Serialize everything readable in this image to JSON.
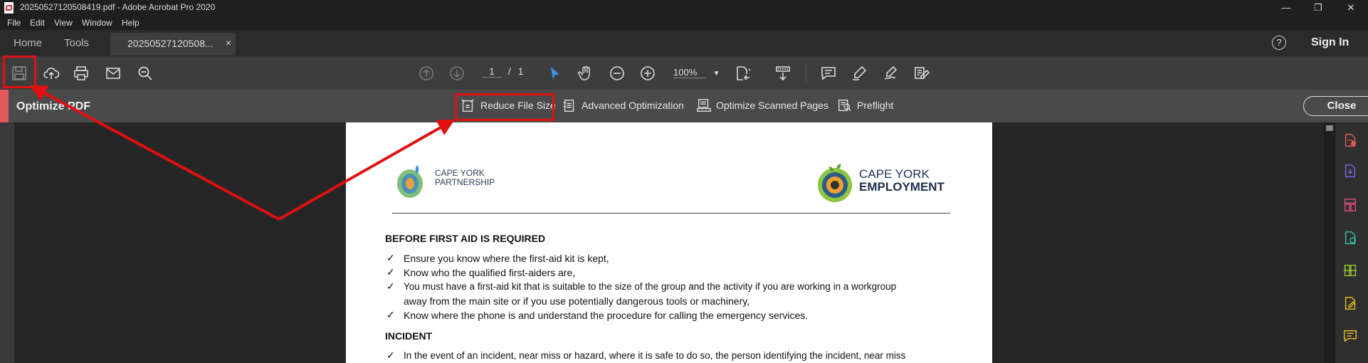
{
  "window": {
    "title": "20250527120508419.pdf - Adobe Acrobat Pro 2020",
    "controls": {
      "minimize": "—",
      "restore": "❐",
      "close": "✕"
    }
  },
  "menu": [
    "File",
    "Edit",
    "View",
    "Window",
    "Help"
  ],
  "tabs": {
    "home": "Home",
    "tools": "Tools",
    "document": "20250527120508...",
    "close": "×"
  },
  "header": {
    "help": "?",
    "sign_in": "Sign In"
  },
  "toolbar": {
    "page_current": "1",
    "page_sep": "/",
    "page_total": "1",
    "zoom": "100%"
  },
  "optimize_bar": {
    "title": "Optimize PDF",
    "tools": [
      "Reduce File Size",
      "Advanced Optimization",
      "Optimize Scanned Pages",
      "Preflight"
    ],
    "close": "Close"
  },
  "document": {
    "logo_left": [
      "CAPE YORK",
      "PARTNERSHIP"
    ],
    "logo_right": [
      "CAPE YORK",
      "EMPLOYMENT"
    ],
    "heading1": "BEFORE FIRST AID IS REQUIRED",
    "items": [
      "Ensure you know where the first-aid kit is kept,",
      "Know who the qualified first-aiders are,",
      "You must have a first-aid kit that is suitable to the size of the group and the activity if you are working in a workgroup",
      "away from the main site or if you use potentially dangerous tools or machinery,",
      "Know where the phone is and understand the procedure for calling the emergency services."
    ],
    "heading2": "INCIDENT",
    "item_incident": "In the event of an incident, near miss or hazard, where it is safe to do so, the person identifying the incident, near miss",
    "check": "✓"
  },
  "colors": {
    "annotation": "#e01010",
    "accent": "#e35858",
    "icon_blue": "#3d8ee6"
  }
}
